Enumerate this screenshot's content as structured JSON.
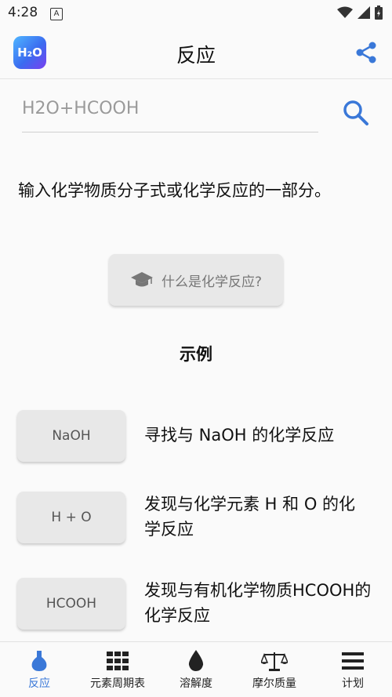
{
  "status_bar": {
    "time": "4:28",
    "notification_icon": "A"
  },
  "app_bar": {
    "title": "反应",
    "logo_text": "H₂O"
  },
  "search": {
    "placeholder": "H2O+HCOOH"
  },
  "description": "输入化学物质分子式或化学反应的一部分。",
  "what_button": {
    "label": "什么是化学反应?"
  },
  "examples": {
    "title": "示例",
    "items": [
      {
        "button": "NaOH",
        "text": "寻找与 NaOH 的化学反应"
      },
      {
        "button": "H + O",
        "text": "发现与化学元素 H 和 O 的化学反应"
      },
      {
        "button": "HCOOH",
        "text": "发现与有机化学物质HCOOH的化学反应"
      }
    ]
  },
  "bottom_nav": [
    {
      "label": "反应",
      "icon": "flask-icon"
    },
    {
      "label": "元素周期表",
      "icon": "grid-icon"
    },
    {
      "label": "溶解度",
      "icon": "drop-icon"
    },
    {
      "label": "摩尔质量",
      "icon": "scale-icon"
    },
    {
      "label": "计划",
      "icon": "menu-icon"
    }
  ],
  "colors": {
    "accent": "#3a78d8",
    "button_bg": "#e8e8e8"
  }
}
